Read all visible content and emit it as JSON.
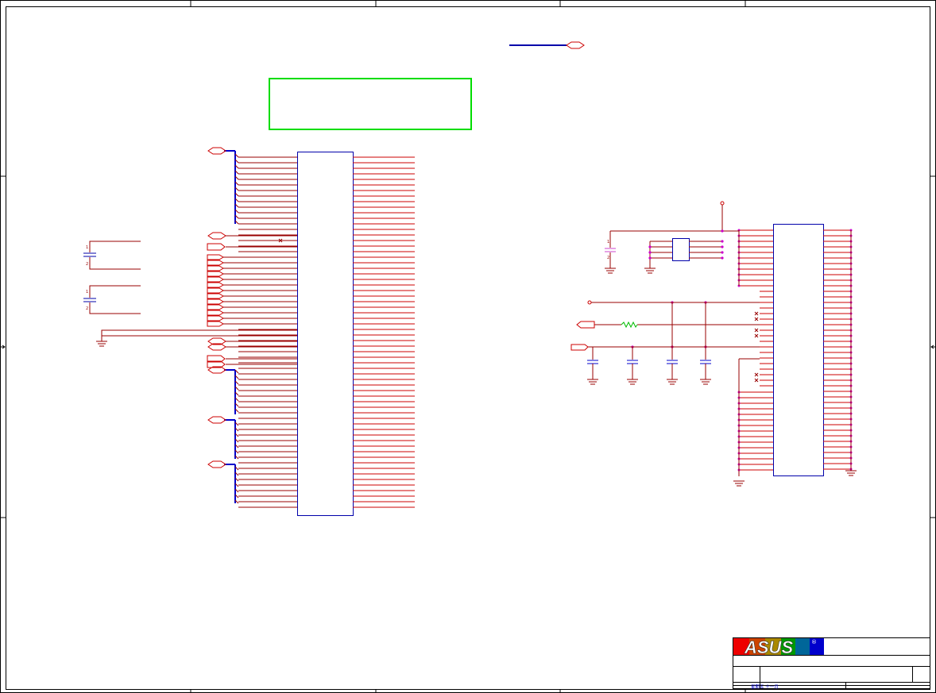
{
  "title_block": {
    "logo_text": "ASUS",
    "registered_mark": "®",
    "date_text": "星期五  十一月"
  },
  "palette": {
    "border": "#000000",
    "wire": "#990000",
    "net_line": "#cc0000",
    "component_body": "#0000aa",
    "bus": "#0000cc",
    "note_box": "#00dd00",
    "junction": "#cc00cc",
    "resistor": "#00bb00",
    "capacitor_highlight": "#cc44cc",
    "logo_blue": "#0000cc",
    "logo_red": "#ee0000",
    "logo_green": "#009900"
  },
  "components": [
    {
      "kind": "connector",
      "label": "left-connector"
    },
    {
      "kind": "connector",
      "label": "right-connector"
    },
    {
      "kind": "resistor-pack",
      "label": "resistor-network"
    },
    {
      "kind": "resistor",
      "label": "series-resistor"
    },
    {
      "kind": "capacitor",
      "label": "decoupling-capacitors"
    }
  ]
}
